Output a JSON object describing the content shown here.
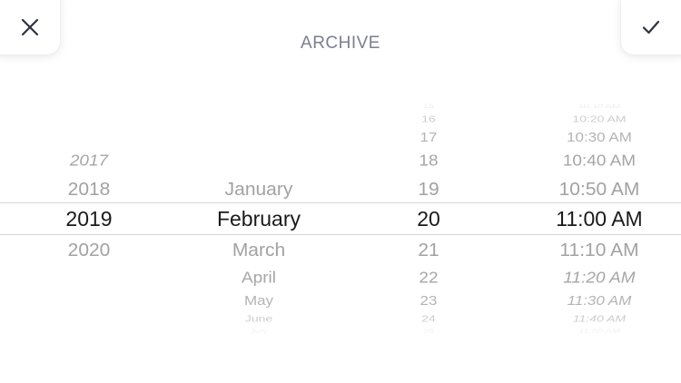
{
  "header": {
    "title": "ARCHIVE",
    "close_icon": "close-icon",
    "confirm_icon": "checkmark-icon"
  },
  "picker": {
    "years": [
      "2017",
      "2018",
      "2019",
      "2020"
    ],
    "months": [
      "January",
      "February",
      "March",
      "April",
      "May",
      "June",
      "July"
    ],
    "days": [
      "15",
      "16",
      "17",
      "18",
      "19",
      "20",
      "21",
      "22",
      "23",
      "24",
      "25"
    ],
    "times": [
      "10:10 AM",
      "10:20 AM",
      "10:30 AM",
      "10:40 AM",
      "10:50 AM",
      "11:00 AM",
      "11:10 AM",
      "11:20 AM",
      "11:30 AM",
      "11:40 AM",
      "11:50 AM"
    ],
    "selected": {
      "year": "2019",
      "month": "February",
      "day": "20",
      "time": "11:00 AM"
    }
  },
  "colors": {
    "title": "#7b7f8e",
    "icon": "#2d3142",
    "selected_text": "#1a1a1a",
    "unselected_text": "#a2a2a2",
    "divider": "#d6d6d6"
  }
}
